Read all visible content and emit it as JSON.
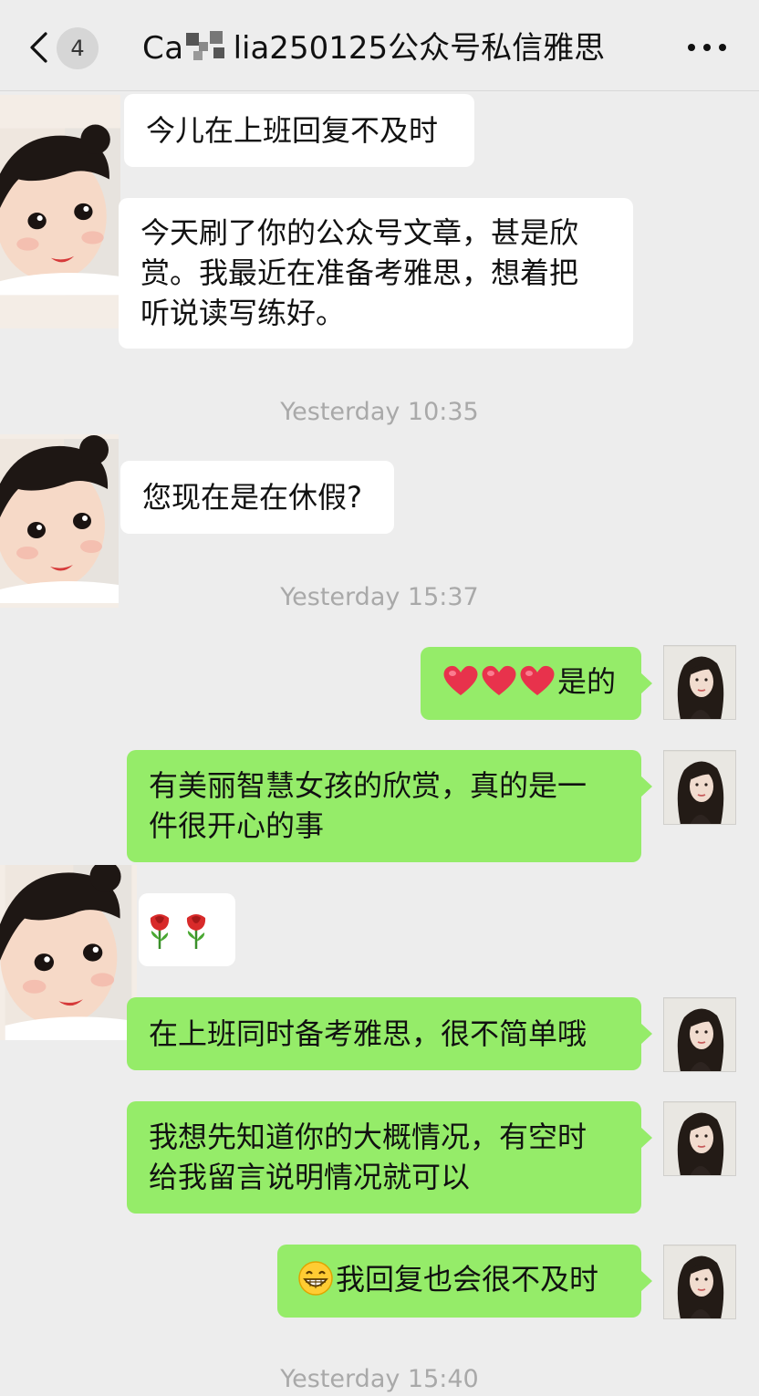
{
  "header": {
    "unread_count": "4",
    "title_prefix": "Ca",
    "title_suffix": "lia250125公众号私信雅思"
  },
  "messages": {
    "m1": "今儿在上班回复不及时",
    "m2_l1": "今天刷了你的公众号文章，甚是欣",
    "m2_l2": "赏。我最近在准备考雅思，想着把",
    "m2_l3": "听说读写练好。",
    "ts1": "Yesterday 10:35",
    "m3": "您现在是在休假?",
    "ts2": "Yesterday 15:37",
    "m4": "是的",
    "m5_l1": "有美丽智慧女孩的欣赏，真的是一",
    "m5_l2": "件很开心的事",
    "m7": "在上班同时备考雅思，很不简单哦",
    "m8_l1": "我想先知道你的大概情况，有空时",
    "m8_l2": "给我留言说明情况就可以",
    "m9": "我回复也会很不及时",
    "ts3": "Yesterday 15:40"
  },
  "icons": {
    "back": "chevron-left-icon",
    "more": "more-dots-icon",
    "heart": "red-heart-emoji",
    "rose": "rose-emoji",
    "grin": "grinning-face-emoji"
  },
  "colors": {
    "background": "#ededed",
    "outgoing_bubble": "#95ec69",
    "incoming_bubble": "#ffffff",
    "timestamp": "#a9a9a9"
  }
}
